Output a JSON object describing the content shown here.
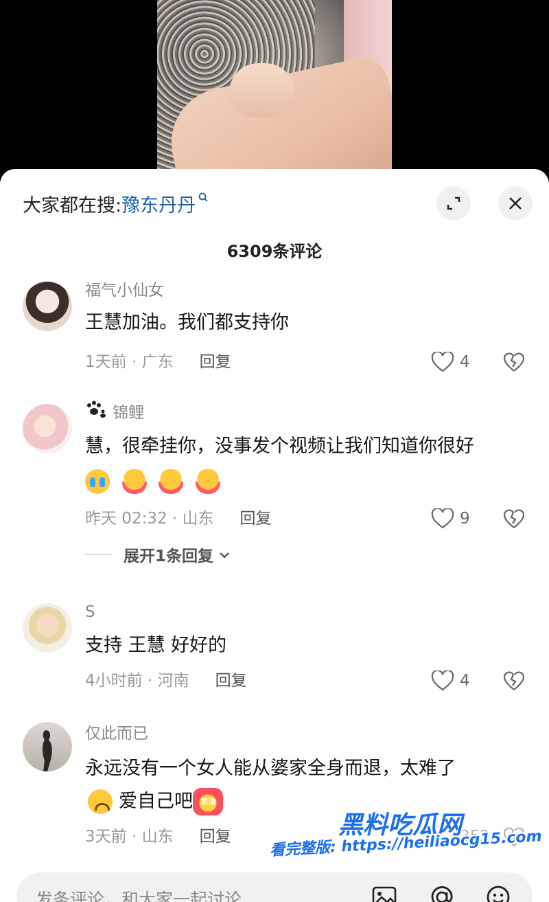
{
  "search": {
    "prefix": "大家都在搜:",
    "term": "豫东丹丹"
  },
  "comment_count": "6309条评论",
  "comments": [
    {
      "user": "福气小仙女",
      "text": "王慧加油。我们都支持你",
      "meta": "1天前 · 广东",
      "reply_label": "回复",
      "likes": "4"
    },
    {
      "user": "锦鲤",
      "user_prefix_icon": "paw-icon",
      "text": "慧，很牵挂你，没事发个视频让我们知道你很好",
      "emojis": [
        "crying-emoji",
        "hug-emoji",
        "hug-emoji",
        "hug-emoji"
      ],
      "meta": "昨天 02:32 · 山东",
      "reply_label": "回复",
      "likes": "9",
      "expand_replies": "展开1条回复"
    },
    {
      "user": "S",
      "text": "支持 王慧 好好的",
      "meta": "4小时前 · 河南",
      "reply_label": "回复",
      "likes": "4"
    },
    {
      "user": "仅此而已",
      "text": "永远没有一个女人能从婆家全身而退，太难了",
      "text2": "爱自己吧",
      "emoji_badge": "加油",
      "meta": "3天前 · 山东",
      "reply_label": "回复",
      "likes": "352"
    }
  ],
  "input": {
    "placeholder": "发条评论，和大家一起讨论"
  },
  "watermark": {
    "logo": "黑料吃瓜网",
    "url": "看完整版: https://heiliaocg15.com"
  },
  "colors": {
    "link_blue": "#1f5fa8",
    "watermark_blue": "#1d6ff0"
  }
}
